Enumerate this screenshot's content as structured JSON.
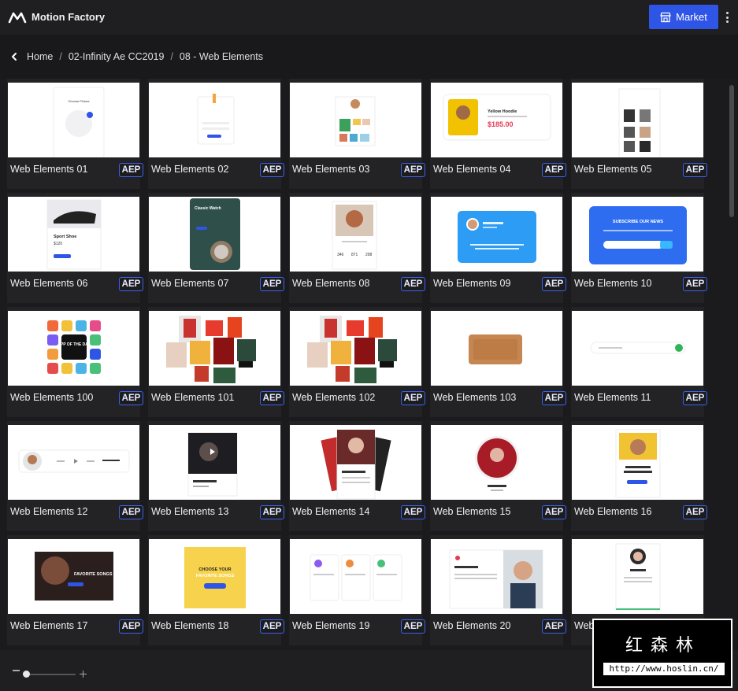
{
  "app": {
    "title": "Motion Factory"
  },
  "toolbar": {
    "market_label": "Market"
  },
  "breadcrumb": [
    "Home",
    "02-Infinity Ae CC2019",
    "08 - Web Elements"
  ],
  "breadcrumb_separator": "/",
  "badge_label": "AEP",
  "items": [
    {
      "label": "Web Elements 01",
      "thumb": "card-white"
    },
    {
      "label": "Web Elements 02",
      "thumb": "form"
    },
    {
      "label": "Web Elements 03",
      "thumb": "profile-grid"
    },
    {
      "label": "Web Elements 04",
      "thumb": "product-yellow"
    },
    {
      "label": "Web Elements 05",
      "thumb": "shop-list"
    },
    {
      "label": "Web Elements 06",
      "thumb": "sport-shoe"
    },
    {
      "label": "Web Elements 07",
      "thumb": "watch-dark"
    },
    {
      "label": "Web Elements 08",
      "thumb": "profile-stats"
    },
    {
      "label": "Web Elements 09",
      "thumb": "tweet-blue"
    },
    {
      "label": "Web Elements 10",
      "thumb": "newsletter-blue"
    },
    {
      "label": "Web Elements 100",
      "thumb": "app-icons"
    },
    {
      "label": "Web Elements 101",
      "thumb": "collage"
    },
    {
      "label": "Web Elements 102",
      "thumb": "collage"
    },
    {
      "label": "Web Elements 103",
      "thumb": "brown-card"
    },
    {
      "label": "Web Elements 11",
      "thumb": "search-bar"
    },
    {
      "label": "Web Elements 12",
      "thumb": "player-bar"
    },
    {
      "label": "Web Elements 13",
      "thumb": "video-card"
    },
    {
      "label": "Web Elements 14",
      "thumb": "stacked-cards"
    },
    {
      "label": "Web Elements 15",
      "thumb": "circle-avatar"
    },
    {
      "label": "Web Elements 16",
      "thumb": "yellow-photo-card"
    },
    {
      "label": "Web Elements 17",
      "thumb": "dark-banner"
    },
    {
      "label": "Web Elements 18",
      "thumb": "yellow-square"
    },
    {
      "label": "Web Elements 19",
      "thumb": "three-cards"
    },
    {
      "label": "Web Elements 20",
      "thumb": "split-profile"
    },
    {
      "label": "Web Elements 21",
      "thumb": "profile-green"
    }
  ],
  "thumb_text": {
    "choose_picture": "Choose Picture",
    "yellow_hoodie": "Yellow Hoodie",
    "price_185": "$185.00",
    "sport_shoe": "Sport Shoe",
    "price_120": "$120",
    "classic_watch": "Classic Watch",
    "subscribe": "SUBSCRIBE OUR NEWS",
    "app_of_the_day": "APP OF THE DAY",
    "choose_your": "CHOOSE YOUR",
    "favorite_songs": "FAVORITE SONGS"
  },
  "colors": {
    "accent": "#2f55e6",
    "badge_border": "#3a63f0",
    "background": "#1b1b1d",
    "card": "#232325"
  },
  "zoom": {
    "level": 0.05
  },
  "watermark": {
    "text": "红森林",
    "url": "http://www.hoslin.cn/"
  }
}
